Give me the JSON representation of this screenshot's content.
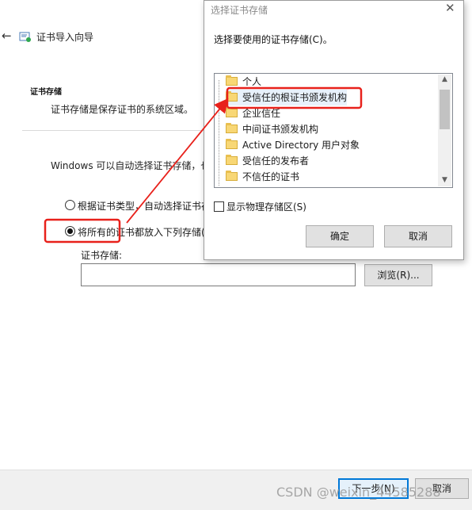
{
  "wizard": {
    "title": "证书导入向导",
    "section_heading": "证书存储",
    "section_desc": "证书存储是保存证书的系统区域。",
    "auto_text": "Windows 可以自动选择证书存储，也",
    "radio_auto_label": "根据证书类型，自动选择证书存",
    "radio_manual_label": "将所有的证书都放入下列存储(",
    "store_label": "证书存储:",
    "store_value": "",
    "browse_label": "浏览(R)...",
    "next_label": "下一步(N)",
    "cancel_label": "取消",
    "selected_option": "manual"
  },
  "dialog": {
    "title": "选择证书存储",
    "close_glyph": "✕",
    "prompt": "选择要使用的证书存储(C)。",
    "stores": [
      {
        "label": "个人"
      },
      {
        "label": "受信任的根证书颁发机构"
      },
      {
        "label": "企业信任"
      },
      {
        "label": "中间证书颁发机构"
      },
      {
        "label": "Active Directory 用户对象"
      },
      {
        "label": "受信任的发布者"
      },
      {
        "label": "不信任的证书"
      }
    ],
    "highlighted_store": "受信任的根证书颁发机构",
    "show_physical_label": "显示物理存储区(S)",
    "show_physical_checked": false,
    "ok_label": "确定",
    "cancel_label": "取消"
  },
  "watermark": "CSDN @weixin_44585288",
  "colors": {
    "annotation_red": "#e8211b",
    "primary_border": "#0078d7",
    "folder_yellow": "#f8d775"
  },
  "icons": {
    "back": "←",
    "scroll_up": "▲",
    "scroll_down": "▼"
  }
}
